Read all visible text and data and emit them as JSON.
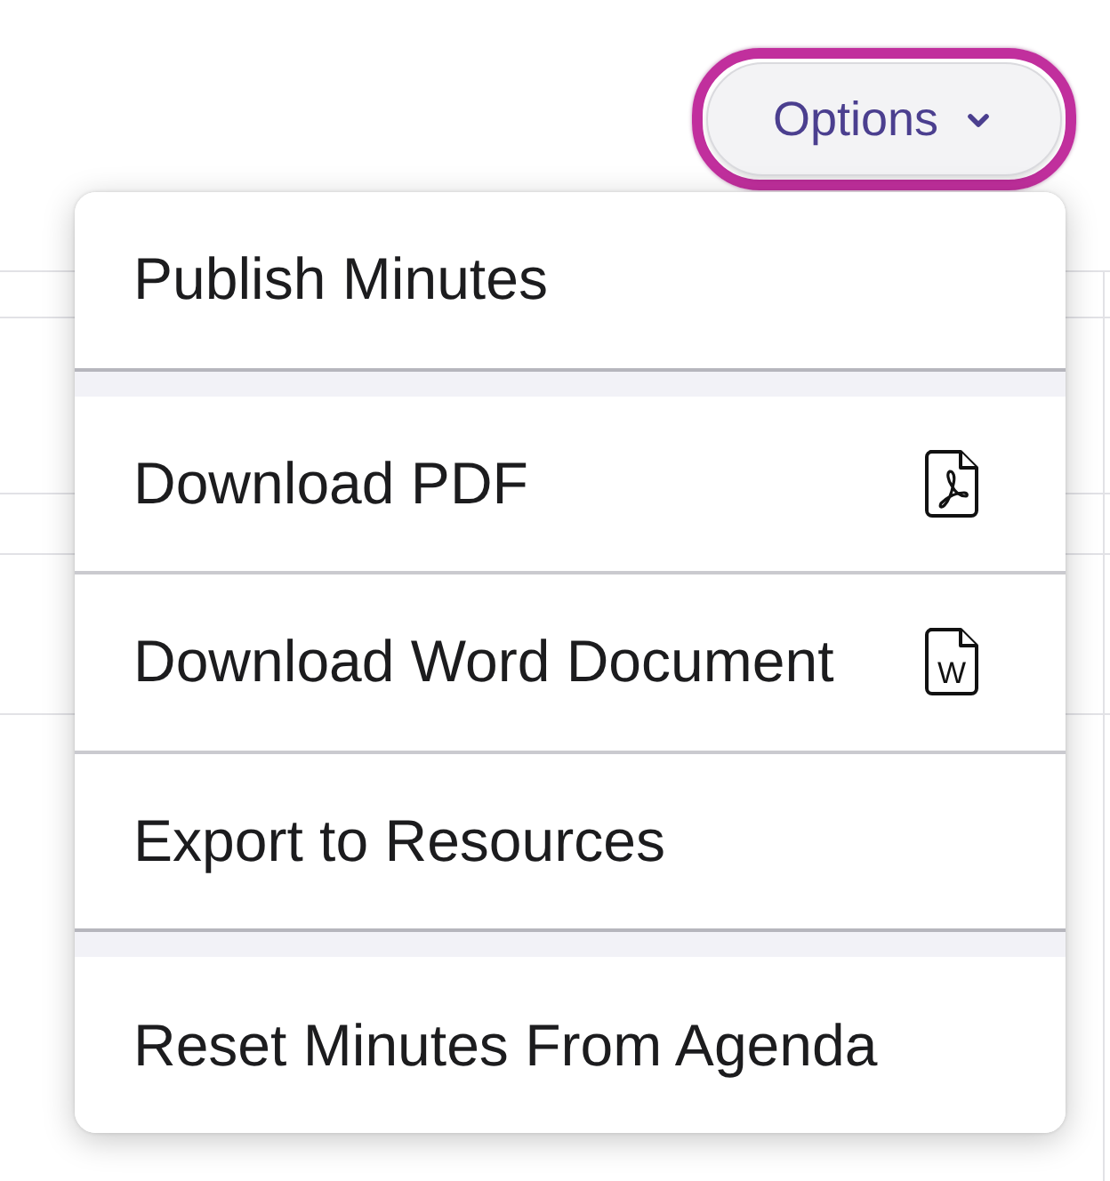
{
  "options_button": {
    "label": "Options",
    "focused": true,
    "expanded": true
  },
  "menu": {
    "groups": [
      {
        "items": [
          {
            "label": "Publish Minutes",
            "kind": "action"
          }
        ]
      },
      {
        "items": [
          {
            "label": "Download PDF",
            "kind": "pdf"
          },
          {
            "label": "Download Word Document",
            "kind": "word",
            "icon_label": "W"
          },
          {
            "label": "Export to Resources",
            "kind": "action"
          }
        ]
      },
      {
        "items": [
          {
            "label": "Reset Minutes From Agenda",
            "kind": "action"
          }
        ]
      }
    ]
  }
}
